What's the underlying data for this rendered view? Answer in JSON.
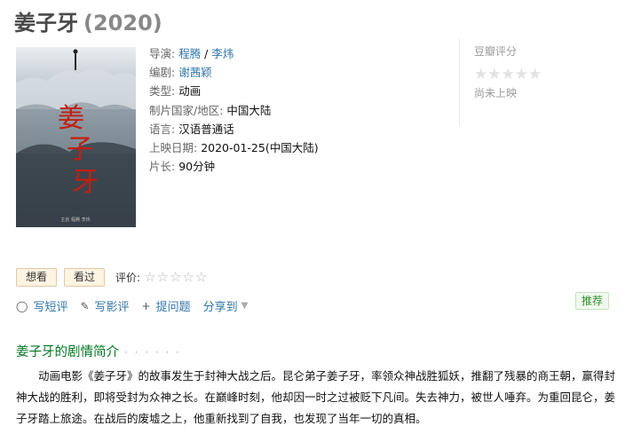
{
  "movie": {
    "title": "姜子牙",
    "year": "(2020)"
  },
  "poster": {
    "title_glyphs": "姜子牙",
    "credit_line": "主创  程腾  李炜"
  },
  "info": {
    "director_label": "导演: ",
    "directors": [
      "程腾",
      "李炜"
    ],
    "separator": " / ",
    "writer_label": "编剧: ",
    "writer": "谢茜颖",
    "genre_label": "类型: ",
    "genre": "动画",
    "country_label": "制片国家/地区: ",
    "country": "中国大陆",
    "language_label": "语言: ",
    "language": "汉语普通话",
    "release_label": "上映日期: ",
    "release": "2020-01-25(中国大陆)",
    "runtime_label": "片长: ",
    "runtime": "90分钟"
  },
  "rating": {
    "title": "豆瓣评分",
    "stars": "★★★★★",
    "note": "尚未上映"
  },
  "actions": {
    "wish": "想看",
    "seen": "看过",
    "rate_label": "评价:",
    "rate_stars": "☆☆☆☆☆"
  },
  "ops": {
    "comment_icon": "◯",
    "comment": "写短评",
    "review_icon": "✎",
    "review": "写影评",
    "question_icon": "+",
    "question": "提问题",
    "share": "分享到",
    "share_caret": "▼"
  },
  "recommend": "推荐",
  "intro": {
    "title": "姜子牙的剧情简介",
    "dots": "· · · · · ·",
    "text": "动画电影《姜子牙》的故事发生于封神大战之后。昆仑弟子姜子牙，率领众神战胜狐妖，推翻了残暴的商王朝，赢得封神大战的胜利，即将受封为众神之长。在巅峰时刻，他却因一时之过被贬下凡间。失去神力，被世人唾弃。为重回昆仑，姜子牙踏上旅途。在战后的废墟之上，他重新找到了自我，也发现了当年一切的真相。"
  },
  "colors": {
    "link": "#3377aa",
    "intro_title": "#007722",
    "wish_bg": "#fff3e2",
    "recommend_text": "#2f8f2f",
    "poster_accent": "#c41e12"
  }
}
